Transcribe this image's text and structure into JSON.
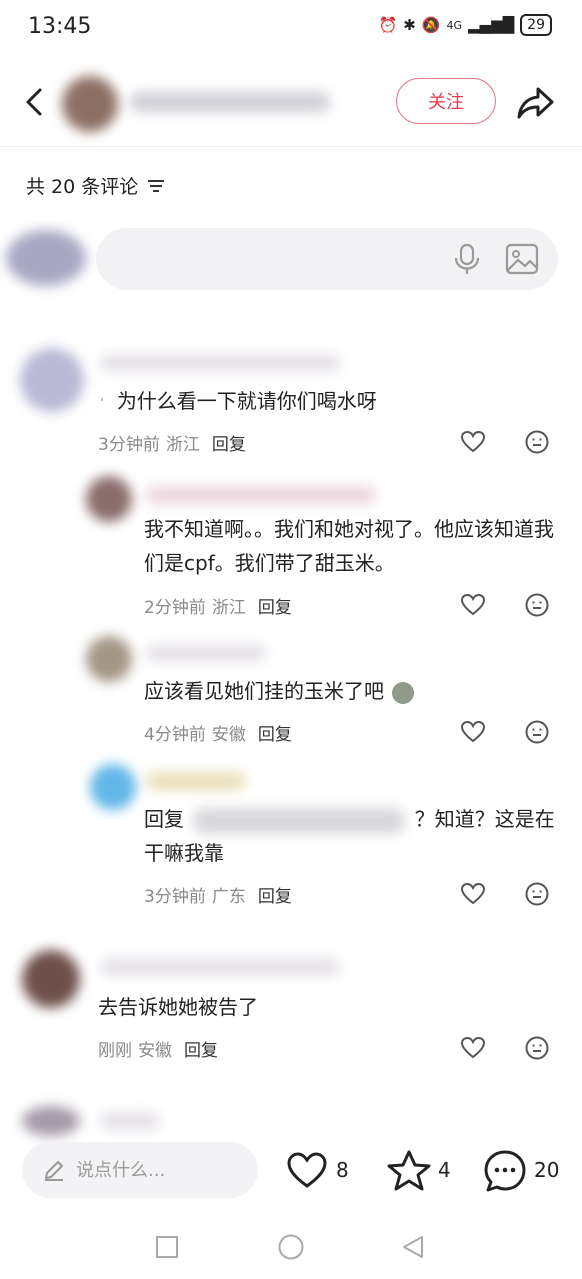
{
  "status": {
    "time": "13:45",
    "network": "4G",
    "battery": "29"
  },
  "header": {
    "follow_label": "关注"
  },
  "comments_header": {
    "count_label": "共 20 条评论"
  },
  "comments": [
    {
      "text": "为什么看一下就请你们喝水呀",
      "prefix": "ʻ",
      "time": "3分钟前",
      "region": "浙江",
      "reply": "回复"
    },
    {
      "text": "我不知道啊。。我们和她对视了。他应该知道我们是cpf。我们带了甜玉米。",
      "time": "2分钟前",
      "region": "浙江",
      "reply": "回复"
    },
    {
      "text": "应该看见她们挂的玉米了吧",
      "time": "4分钟前",
      "region": "安徽",
      "reply": "回复"
    },
    {
      "text_before": "回复",
      "text_after": "？知道？这是在干嘛我靠",
      "time": "3分钟前",
      "region": "广东",
      "reply": "回复"
    },
    {
      "text": "去告诉她她被告了",
      "time": "刚刚",
      "region": "安徽",
      "reply": "回复"
    }
  ],
  "bottom": {
    "placeholder": "说点什么...",
    "likes": "8",
    "stars": "4",
    "comments": "20"
  }
}
